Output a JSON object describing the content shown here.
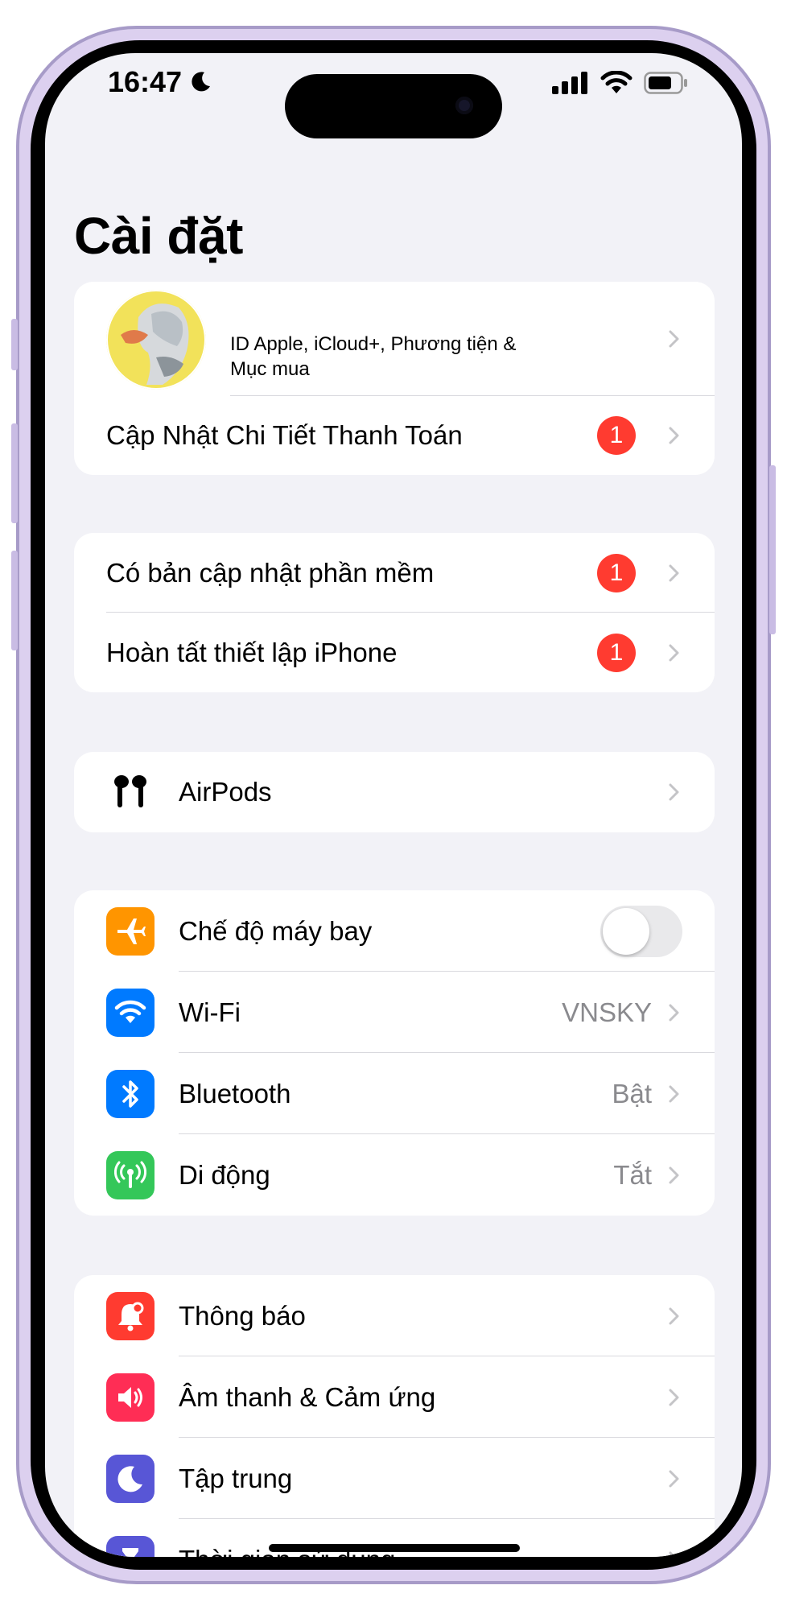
{
  "status_bar": {
    "time": "16:47",
    "icons": [
      "moon-icon",
      "signal-icon",
      "wifi-icon",
      "battery-icon"
    ]
  },
  "title": "Cài đặt",
  "account": {
    "subtitle_line1": "ID Apple, iCloud+, Phương tiện &",
    "subtitle_line2": "Mục mua",
    "payment_row": "Cập Nhật Chi Tiết Thanh Toán",
    "payment_badge": "1"
  },
  "updates": [
    {
      "label": "Có bản cập nhật phần mềm",
      "badge": "1"
    },
    {
      "label": "Hoàn tất thiết lập iPhone",
      "badge": "1"
    }
  ],
  "airpods": {
    "label": "AirPods",
    "icon": "airpods-icon"
  },
  "connectivity": {
    "airplane": {
      "label": "Chế độ máy bay",
      "icon": "airplane-icon",
      "color": "#ff9500",
      "toggle_on": false
    },
    "wifi": {
      "label": "Wi-Fi",
      "value": "VNSKY",
      "icon": "wifi-icon",
      "color": "#007aff"
    },
    "bluetooth": {
      "label": "Bluetooth",
      "value": "Bật",
      "icon": "bluetooth-icon",
      "color": "#007aff"
    },
    "cellular": {
      "label": "Di động",
      "value": "Tắt",
      "icon": "antenna-icon",
      "color": "#34c759"
    }
  },
  "notifications_group": [
    {
      "label": "Thông báo",
      "icon": "bell-icon",
      "color": "#ff3b30"
    },
    {
      "label": "Âm thanh & Cảm ứng",
      "icon": "speaker-icon",
      "color": "#ff2d55"
    },
    {
      "label": "Tập trung",
      "icon": "moon-icon",
      "color": "#5856d6"
    },
    {
      "label": "Thời gian sử dụng",
      "icon": "hourglass-icon",
      "color": "#5856d6"
    }
  ],
  "colors": {
    "background": "#f2f2f7",
    "badge": "#ff3b30",
    "frame": "#dcd0ef"
  }
}
